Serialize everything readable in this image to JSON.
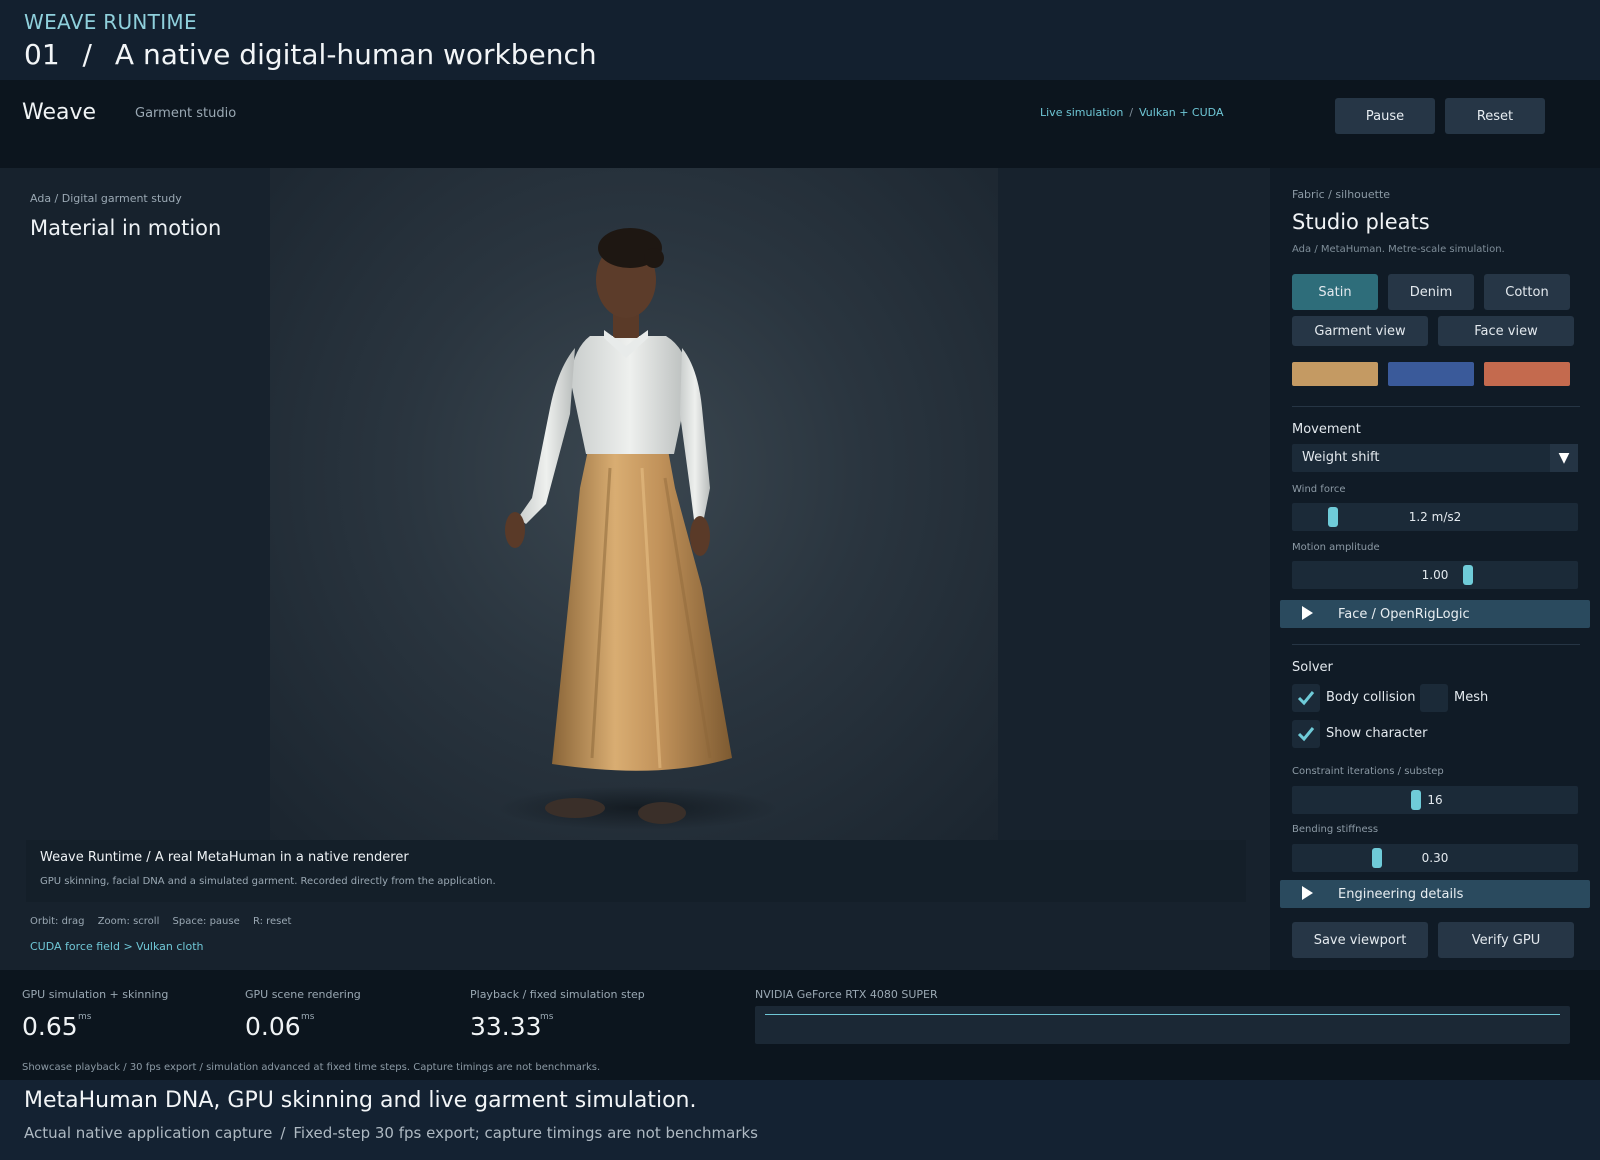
{
  "slide": {
    "eyebrow": "WEAVE RUNTIME",
    "number": "01",
    "separator": "/",
    "headline": "A native digital-human workbench"
  },
  "header": {
    "brand": "Weave",
    "section": "Garment studio",
    "status_left": "Live simulation",
    "status_sep": "/",
    "status_right": "Vulkan + CUDA",
    "pause_label": "Pause",
    "reset_label": "Reset"
  },
  "viewport": {
    "breadcrumb": "Ada / Digital garment study",
    "title": "Material in motion",
    "caption_title": "Weave Runtime / A real MetaHuman in a native renderer",
    "caption_sub": "GPU skinning, facial DNA and a simulated garment. Recorded directly from the application.",
    "shortcuts": [
      "Orbit: drag",
      "Zoom: scroll",
      "Space: pause",
      "R: reset"
    ],
    "force_link": "CUDA force field > Vulkan cloth"
  },
  "panel": {
    "eyebrow": "Fabric / silhouette",
    "title": "Studio pleats",
    "subtitle": "Ada / MetaHuman. Metre-scale simulation.",
    "materials": [
      {
        "label": "Satin",
        "active": true
      },
      {
        "label": "Denim",
        "active": false
      },
      {
        "label": "Cotton",
        "active": false
      }
    ],
    "views": [
      "Garment view",
      "Face view"
    ],
    "swatches": [
      "#c49a63",
      "#3a5a9a",
      "#c46a4e"
    ],
    "movement_label": "Movement",
    "movement_value": "Weight shift",
    "wind_label": "Wind force",
    "wind_value": "1.2 m/s2",
    "wind_level": 0.13,
    "amplitude_label": "Motion amplitude",
    "amplitude_value": "1.00",
    "amplitude_level": 0.62,
    "face_section": "Face / OpenRigLogic",
    "solver_label": "Solver",
    "body_collision_label": "Body collision",
    "body_collision": true,
    "mesh_label": "Mesh",
    "mesh": false,
    "show_character_label": "Show character",
    "show_character": true,
    "iterations_label": "Constraint iterations / substep",
    "iterations_value": "16",
    "iterations_level": 0.43,
    "bending_label": "Bending stiffness",
    "bending_value": "0.30",
    "bending_level": 0.29,
    "engineering_section": "Engineering details",
    "save_label": "Save viewport",
    "verify_label": "Verify GPU"
  },
  "metrics": [
    {
      "label": "GPU simulation + skinning",
      "value": "0.65",
      "unit": "ms"
    },
    {
      "label": "GPU scene rendering",
      "value": "0.06",
      "unit": "ms"
    },
    {
      "label": "Playback / fixed simulation step",
      "value": "33.33",
      "unit": "ms"
    }
  ],
  "gpu_name": "NVIDIA GeForce RTX 4080 SUPER",
  "metrics_note": "Showcase playback / 30 fps export / simulation advanced at fixed time steps. Capture timings are not benchmarks.",
  "footer": {
    "title": "MetaHuman DNA, GPU skinning and live garment simulation.",
    "sub_left": "Actual native application capture",
    "sub_sep": "/",
    "sub_right": "Fixed-step 30 fps export; capture timings are not benchmarks"
  },
  "colors": {
    "accent": "#6fc7d6",
    "active_button": "#2e6d7a",
    "section_bar": "#2a4a5e"
  }
}
